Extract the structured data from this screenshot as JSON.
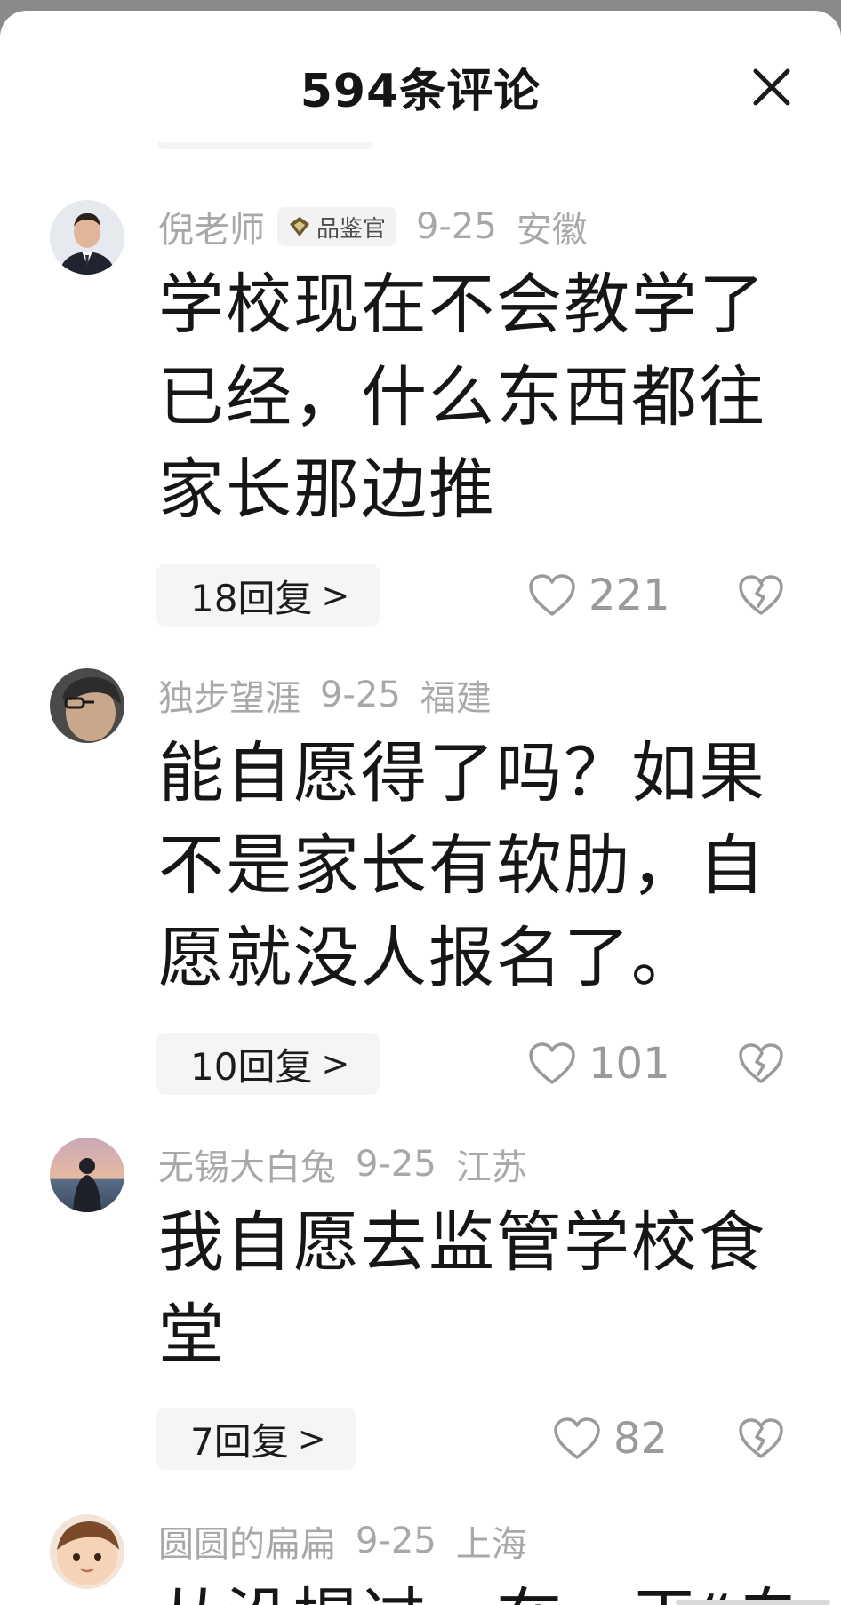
{
  "header": {
    "title": "594条评论"
  },
  "comments": [
    {
      "username": "倪老师",
      "badge": "品鉴官",
      "date": "9-25",
      "location": "安徽",
      "content": "学校现在不会教学了已经，什么东西都往家长那边推",
      "reply_label": "18回复",
      "likes": "221"
    },
    {
      "username": "独步望涯",
      "date": "9-25",
      "location": "福建",
      "content": "能自愿得了吗？如果不是家长有软肋，自愿就没人报名了。",
      "reply_label": "10回复",
      "likes": "101"
    },
    {
      "username": "无锡大白兔",
      "date": "9-25",
      "location": "江苏",
      "content": "我自愿去监管学校食堂",
      "reply_label": "7回复",
      "likes": "82"
    },
    {
      "username": "圆圆的扁扁",
      "date": "9-25",
      "location": "上海",
      "content": "从没提过一在一干“自"
    }
  ],
  "icons": {
    "close": "close-icon",
    "like": "heart-outline-icon",
    "dislike": "broken-heart-icon",
    "badge": "diamond-badge-icon",
    "chevron": "chevron-right-icon"
  },
  "colors": {
    "text_primary": "#161616",
    "text_meta": "#a8a8a8",
    "chip_bg": "#f5f5f5",
    "backdrop": "#8a8a8a"
  }
}
